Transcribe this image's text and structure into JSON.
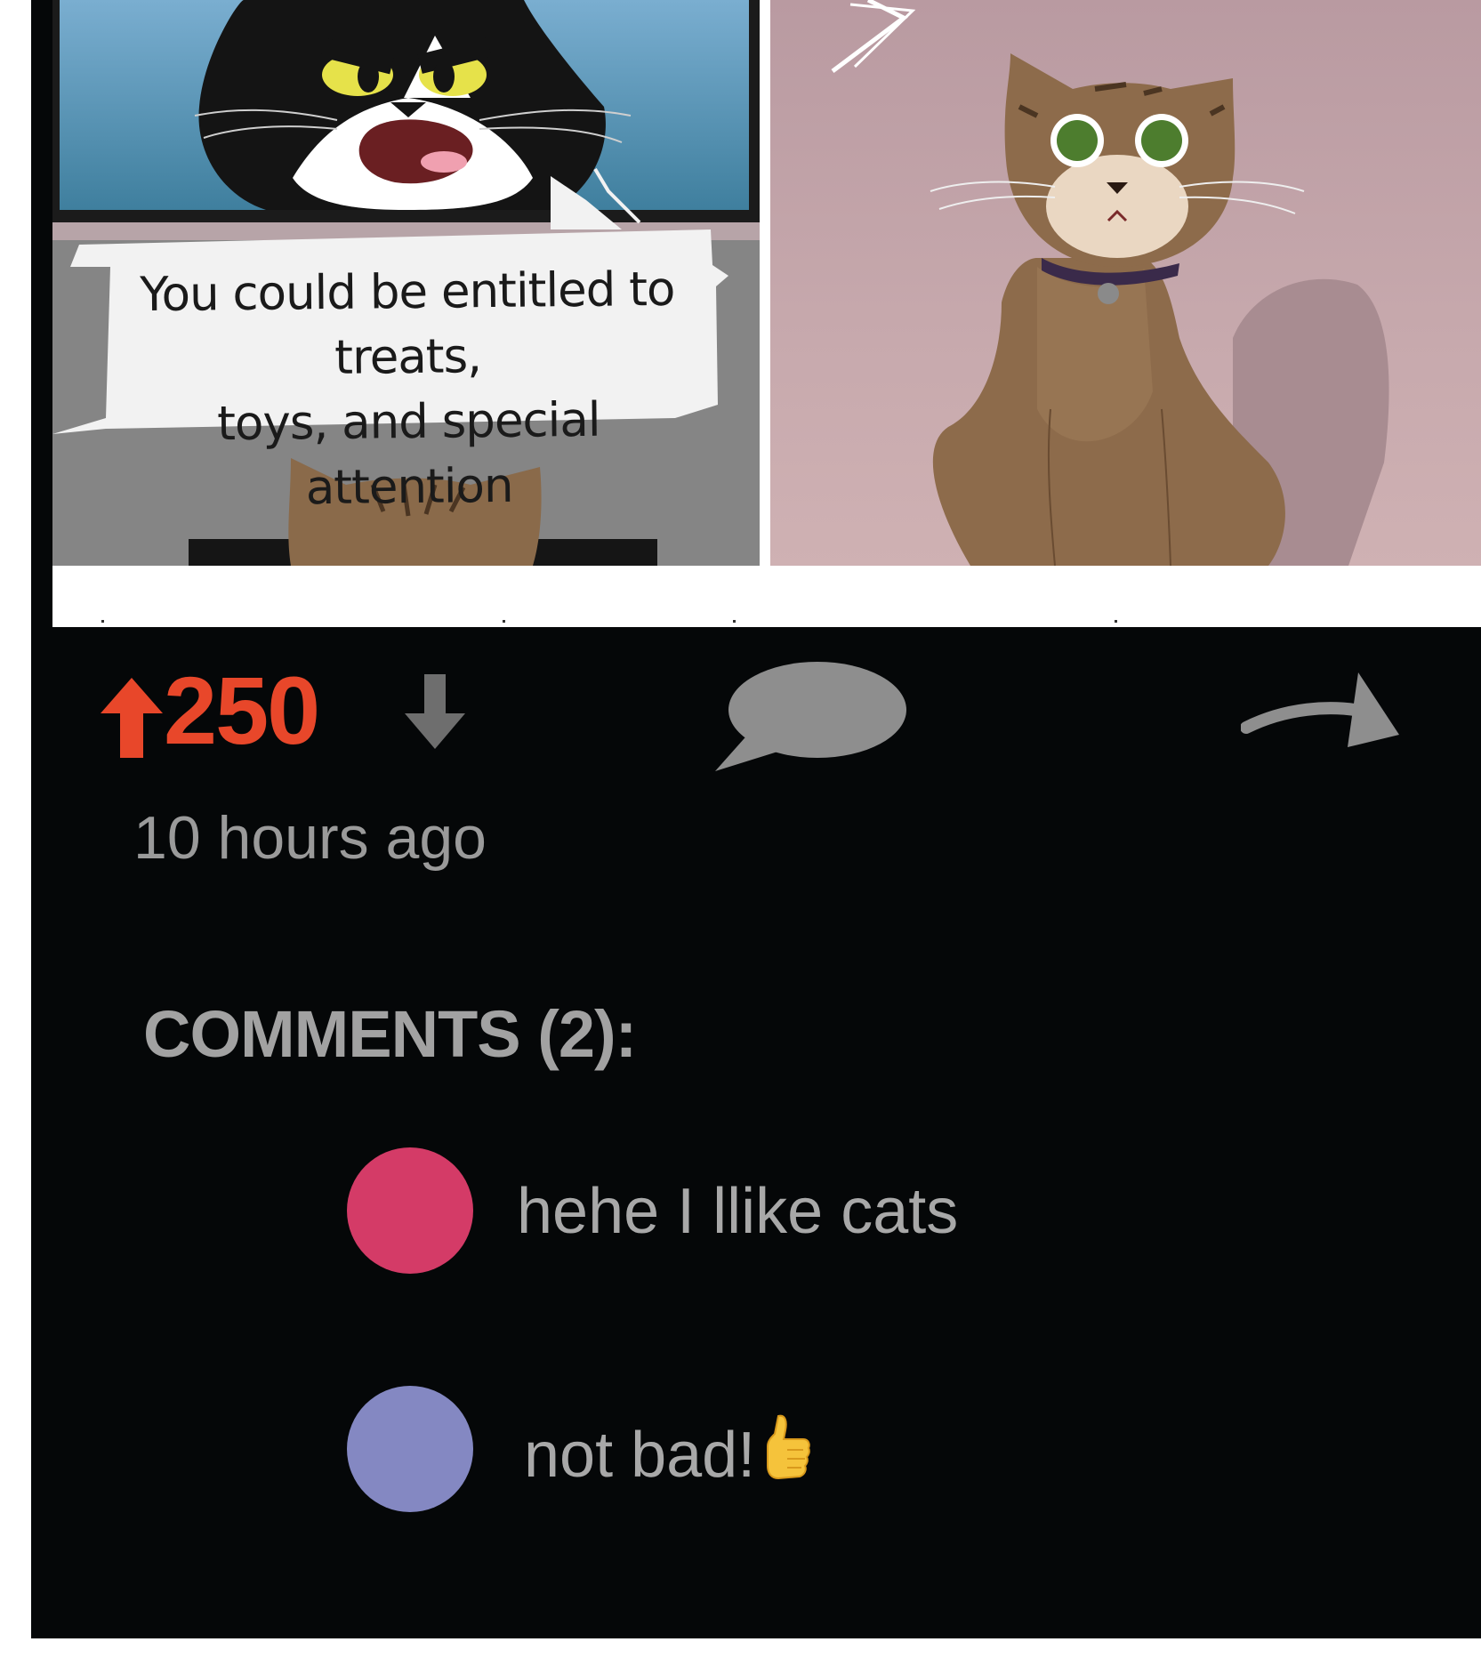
{
  "comic": {
    "caption_line1": "You could be entitled to treats,",
    "caption_line2": "toys, and special attention"
  },
  "post": {
    "score": "250",
    "timestamp": "10 hours ago"
  },
  "icons": {
    "upvote": "arrow-up-icon",
    "downvote": "arrow-down-icon",
    "comment": "speech-bubble-icon",
    "share": "curved-arrow-share-icon",
    "thumbs_up": "thumbs-up-icon"
  },
  "colors": {
    "score": "#e8472a",
    "avatar_1": "#d43b67",
    "avatar_2": "#8488c2",
    "background": "#050708"
  },
  "comments": {
    "heading": "COMMENTS (2):",
    "items": [
      {
        "text": "hehe I llike cats"
      },
      {
        "text": "not bad!"
      }
    ]
  }
}
